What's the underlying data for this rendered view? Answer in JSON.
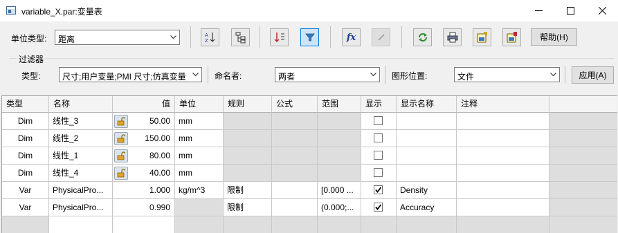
{
  "window": {
    "title": "variable_X.par:变量表"
  },
  "toolbar": {
    "unit_type_label": "单位类型:",
    "unit_type_value": "距离",
    "help_label": "帮助(H)",
    "fx_label": "fx"
  },
  "filter": {
    "group_label": "过滤器",
    "type_label": "类型:",
    "type_value": "尺寸;用户变量;PMI 尺寸;仿真变量",
    "namer_label": "命名者:",
    "namer_value": "两者",
    "graphic_pos_label": "图形位置:",
    "graphic_pos_value": "文件",
    "apply_label": "应用(A)"
  },
  "table": {
    "columns": [
      "类型",
      "名称",
      "值",
      "单位",
      "规则",
      "公式",
      "范围",
      "显示",
      "显示名称",
      "注释"
    ],
    "rows": [
      {
        "type": "Dim",
        "name": "线性_3",
        "value": "50.00",
        "unit": "mm",
        "rule": "",
        "formula": "",
        "range": "",
        "show": false,
        "display_name": "",
        "comment": ""
      },
      {
        "type": "Dim",
        "name": "线性_2",
        "value": "150.00",
        "unit": "mm",
        "rule": "",
        "formula": "",
        "range": "",
        "show": false,
        "display_name": "",
        "comment": ""
      },
      {
        "type": "Dim",
        "name": "线性_1",
        "value": "80.00",
        "unit": "mm",
        "rule": "",
        "formula": "",
        "range": "",
        "show": false,
        "display_name": "",
        "comment": ""
      },
      {
        "type": "Dim",
        "name": "线性_4",
        "value": "40.00",
        "unit": "mm",
        "rule": "",
        "formula": "",
        "range": "",
        "show": false,
        "display_name": "",
        "comment": ""
      },
      {
        "type": "Var",
        "name": "PhysicalPro...",
        "value": "1.000",
        "unit": "kg/m^3",
        "rule": "限制",
        "formula": "",
        "range": "[0.000 ...",
        "show": true,
        "display_name": "Density",
        "comment": ""
      },
      {
        "type": "Var",
        "name": "PhysicalPro...",
        "value": "0.990",
        "unit": "",
        "rule": "限制",
        "formula": "",
        "range": "(0.000;...",
        "show": true,
        "display_name": "Accuracy",
        "comment": ""
      }
    ]
  },
  "colors": {
    "accent": "#0078d7",
    "header_bg": "#f4f4f4",
    "disabled_cell": "#dedede"
  }
}
